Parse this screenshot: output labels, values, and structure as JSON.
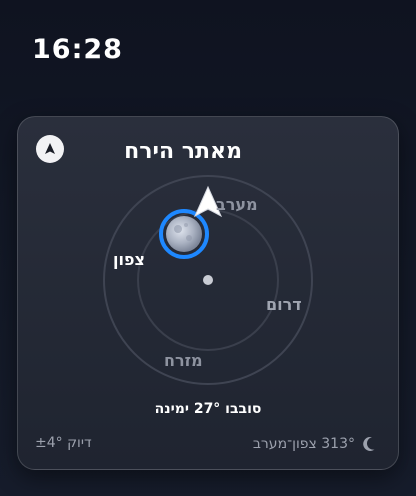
{
  "status_bar": {
    "time": "16:28"
  },
  "card": {
    "title": "מאתר הירח",
    "badge_icon": "up-arrow-icon",
    "directions": {
      "west": "מערב",
      "north": "צפון",
      "south": "דרום",
      "east": "מזרח"
    },
    "rotate_instruction": "סובבו 27° ימינה",
    "accuracy": "דיוק ±4°",
    "bearing": "313° צפון־מערב",
    "bearing_icon": "crescent-moon-icon"
  },
  "colors": {
    "accent": "#1e88ff",
    "background": "#121826",
    "card": "#262b37"
  }
}
